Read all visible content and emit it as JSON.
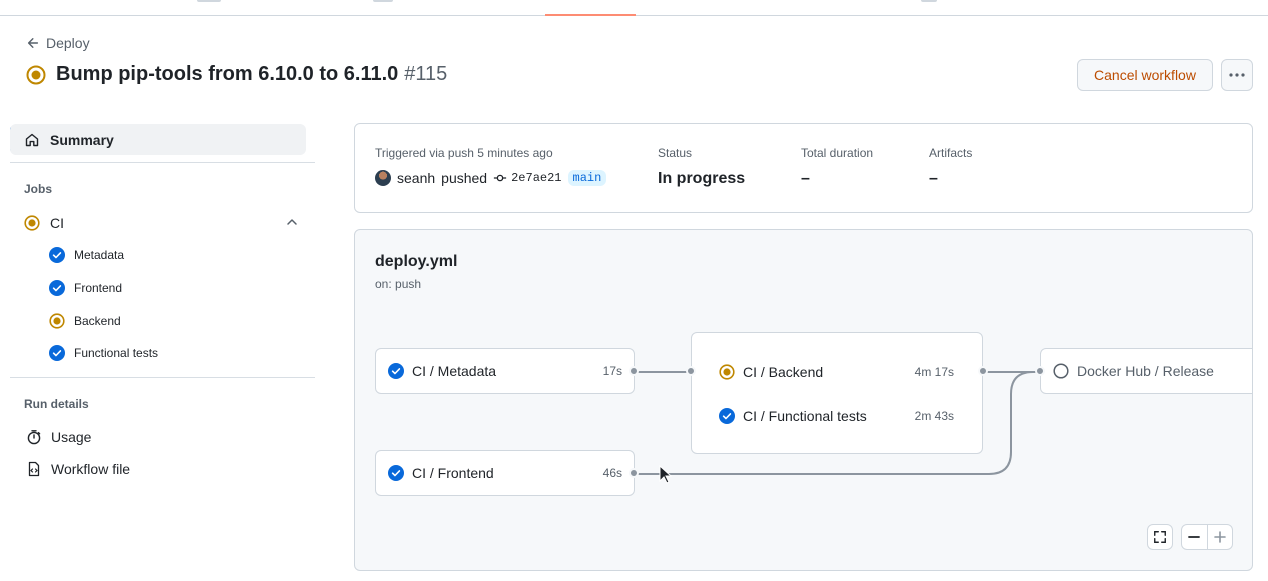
{
  "header": {
    "back_label": "Deploy",
    "title": "Bump pip-tools from 6.10.0 to 6.11.0",
    "run_number": "#115",
    "cancel_label": "Cancel workflow",
    "status_color": "#bf8700"
  },
  "sidebar": {
    "summary_label": "Summary",
    "jobs_heading": "Jobs",
    "ci_label": "CI",
    "subjobs": [
      {
        "label": "Metadata",
        "status": "success"
      },
      {
        "label": "Frontend",
        "status": "success"
      },
      {
        "label": "Backend",
        "status": "in_progress"
      },
      {
        "label": "Functional tests",
        "status": "success"
      }
    ],
    "run_details_heading": "Run details",
    "usage_label": "Usage",
    "workflow_file_label": "Workflow file"
  },
  "trigger": {
    "triggered_text": "Triggered via push 5 minutes ago",
    "user": "seanh",
    "pushed_word": "pushed",
    "commit_sha": "2e7ae21",
    "branch": "main",
    "status_label": "Status",
    "status_value": "In progress",
    "duration_label": "Total duration",
    "duration_value": "–",
    "artifacts_label": "Artifacts",
    "artifacts_value": "–"
  },
  "graph": {
    "workflow_file": "deploy.yml",
    "trigger_event": "on: push",
    "jobs": {
      "metadata": {
        "label": "CI / Metadata",
        "duration": "17s",
        "status": "success"
      },
      "frontend": {
        "label": "CI / Frontend",
        "duration": "46s",
        "status": "success"
      },
      "backend": {
        "label": "CI / Backend",
        "duration": "4m 17s",
        "status": "in_progress"
      },
      "functional": {
        "label": "CI / Functional tests",
        "duration": "2m 43s",
        "status": "success"
      },
      "docker": {
        "label": "Docker Hub / Release",
        "duration": "",
        "status": "pending"
      }
    }
  },
  "colors": {
    "accent": "#0969da",
    "success": "#0969da",
    "in_progress": "#bf8700",
    "danger_text": "#bc4c00",
    "tab_underline": "#fd8c73"
  }
}
